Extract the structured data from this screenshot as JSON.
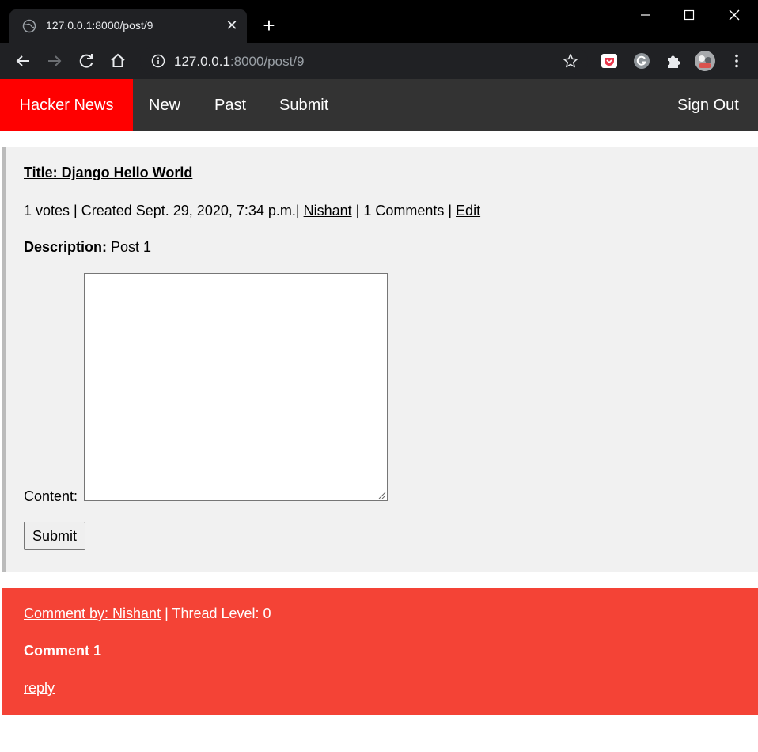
{
  "browser": {
    "tab_title": "127.0.0.1:8000/post/9",
    "url_host": "127.0.0.1",
    "url_rest": ":8000/post/9",
    "new_tab_glyph": "+",
    "close_glyph": "✕"
  },
  "nav": {
    "brand": "Hacker News",
    "links": [
      "New",
      "Past",
      "Submit"
    ],
    "sign_out": "Sign Out"
  },
  "post": {
    "title": "Title: Django Hello World",
    "meta_prefix": "1 votes | Created Sept. 29, 2020, 7:34 p.m.|",
    "author": "Nishant",
    "meta_mid": "| 1 Comments |",
    "edit": "Edit",
    "description_label": "Description:",
    "description": "Post 1",
    "content_label": "Content:",
    "content_value": "",
    "submit": "Submit"
  },
  "comment": {
    "by": "Comment by: Nishant",
    "thread": "| Thread Level: 0",
    "body": "Comment 1",
    "reply": "reply"
  },
  "colors": {
    "brand_red": "#ff0000",
    "nav_bg": "#333333",
    "post_bg": "#f1f1f1",
    "comment_bg": "#f44336"
  }
}
